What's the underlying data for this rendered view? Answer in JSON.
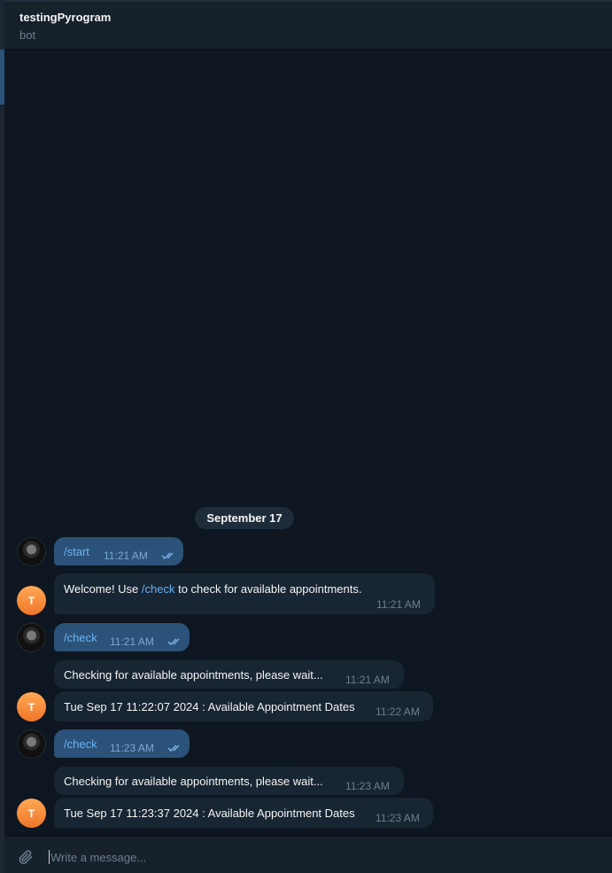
{
  "header": {
    "title": "testingPyrogram",
    "status": "bot"
  },
  "date_divider": "September 17",
  "bot_avatar_initial": "T",
  "messages": [
    {
      "from": "me",
      "text": "/start",
      "time": "11:21 AM",
      "status": "read"
    },
    {
      "from": "bot",
      "text_before": "Welcome! Use ",
      "command": "/check",
      "text_after": " to check for available appointments.",
      "time": "11:21 AM"
    },
    {
      "from": "me",
      "text": "/check",
      "time": "11:21 AM",
      "status": "read"
    },
    {
      "from": "bot",
      "text": "Checking for available appointments, please wait...",
      "time": "11:21 AM"
    },
    {
      "from": "bot",
      "text": "Tue Sep 17 11:22:07 2024 : Available Appointment Dates",
      "time": "11:22 AM"
    },
    {
      "from": "me",
      "text": "/check",
      "time": "11:23 AM",
      "status": "read"
    },
    {
      "from": "bot",
      "text": "Checking for available appointments, please wait...",
      "time": "11:23 AM"
    },
    {
      "from": "bot",
      "text": "Tue Sep 17 11:23:37 2024 : Available Appointment Dates",
      "time": "11:23 AM"
    }
  ],
  "composer": {
    "placeholder": "Write a message...",
    "attach_icon": "paperclip-icon"
  },
  "colors": {
    "background": "#0e1621",
    "outgoing_bubble": "#2b5278",
    "incoming_bubble": "#182533",
    "link": "#6ab3f3",
    "bot_avatar": "#f0762a"
  }
}
